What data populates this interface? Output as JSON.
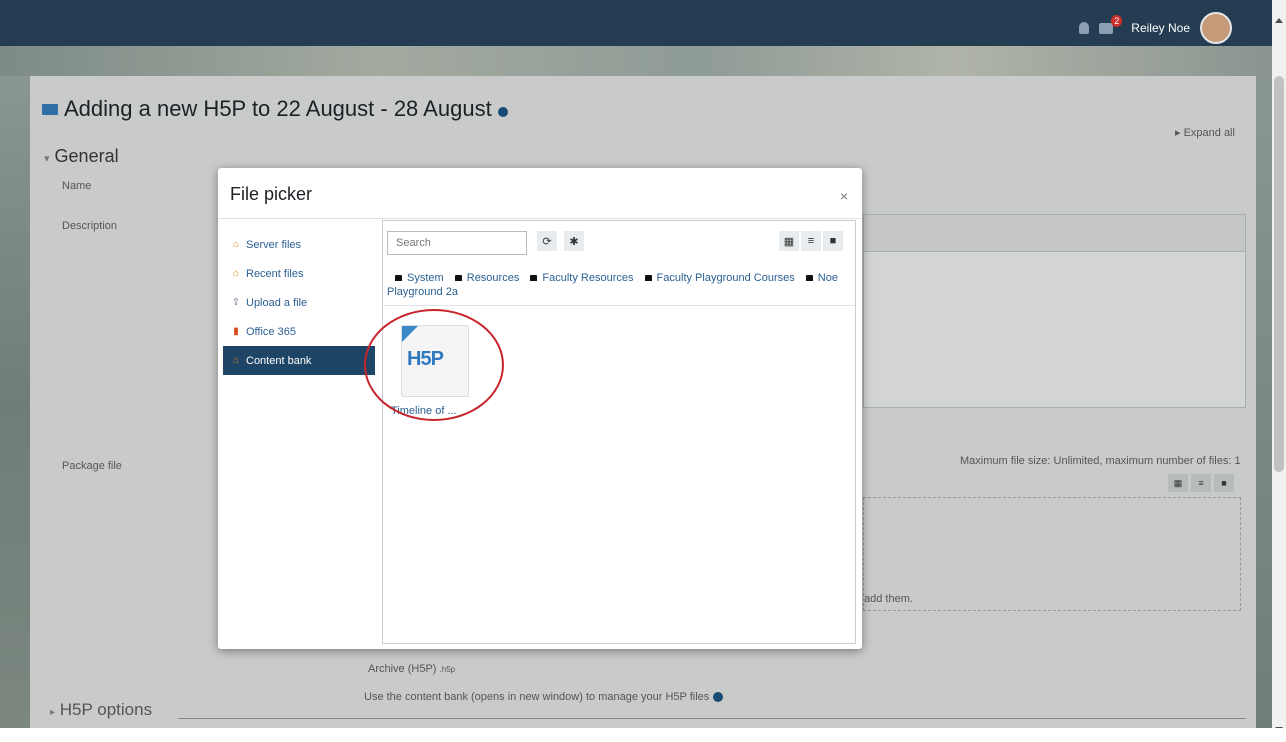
{
  "header": {
    "user_name": "Reiley Noe",
    "notification_count": "2"
  },
  "page": {
    "title": "Adding a new H5P to 22 August - 28 August",
    "expand_all": "Expand all",
    "section_general": "General",
    "label_name": "Name",
    "label_description": "Description",
    "label_package": "Package file",
    "max_size_note": "Maximum file size: Unlimited, maximum number of files: 1",
    "drop_text": "add them.",
    "archive_type": "Archive (H5P)",
    "archive_ext": ".h5p",
    "content_bank_note": "Use the content bank (opens in new window) to manage your H5P files",
    "section_h5p_options": "H5P options"
  },
  "modal": {
    "title": "File picker",
    "close": "×",
    "repositories": [
      {
        "label": "Server files",
        "icon": "home-icon"
      },
      {
        "label": "Recent files",
        "icon": "home-icon"
      },
      {
        "label": "Upload a file",
        "icon": "upload-icon"
      },
      {
        "label": "Office 365",
        "icon": "office-icon"
      },
      {
        "label": "Content bank",
        "icon": "content-bank-icon",
        "active": true
      }
    ],
    "search_placeholder": "Search",
    "breadcrumb": [
      "System",
      "Resources",
      "Faculty Resources",
      "Faculty Playground Courses",
      "Noe Playground 2a"
    ],
    "files": [
      {
        "name": "Timeline of ...",
        "type": "H5P"
      }
    ]
  },
  "colors": {
    "topbar": "#243d52",
    "active_repo": "#1e4466",
    "link": "#2b5f93",
    "highlight_circle": "#c8242b"
  }
}
